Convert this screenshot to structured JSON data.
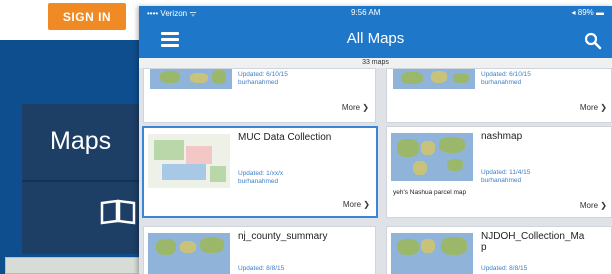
{
  "background_app": {
    "sign_in_label": "SIGN IN",
    "side_label": "Maps",
    "side_icon": "book-icon",
    "colors": {
      "blue": "#0f4e8e",
      "orange": "#f08a24",
      "panel": "#1d3f66"
    }
  },
  "status_bar": {
    "carrier": "•••• Verizon ᯤ",
    "time": "9:56 AM",
    "battery": "◂ 89% ▬"
  },
  "nav": {
    "title": "All Maps",
    "menu_icon": "hamburger-menu-icon",
    "search_icon": "search-icon",
    "color": "#1f77c9"
  },
  "map_count": "33 maps",
  "cards": [
    {
      "title": "",
      "updated": "Updated: 6/10/15",
      "owner": "burhanahmed",
      "description": "",
      "more": "More ❯"
    },
    {
      "title": "",
      "updated": "Updated: 6/10/15",
      "owner": "burhanahmed",
      "description": "",
      "more": "More ❯"
    },
    {
      "title": "MUC Data Collection",
      "updated": "Updated: 1/xx/x",
      "owner": "burhanahmed",
      "description": "",
      "more": "More ❯"
    },
    {
      "title": "nashmap",
      "updated": "Updated: 11/4/15",
      "owner": "burhanahmed",
      "description": "yeh's Nashua parcel map",
      "more": "More ❯"
    },
    {
      "title": "nj_county_summary",
      "updated": "Updated: 8/8/15",
      "owner": "",
      "description": "",
      "more": ""
    },
    {
      "title": "NJDOH_Collection_Ma",
      "title_line2": "p",
      "updated": "Updated: 8/8/15",
      "owner": "",
      "description": "",
      "more": ""
    }
  ]
}
